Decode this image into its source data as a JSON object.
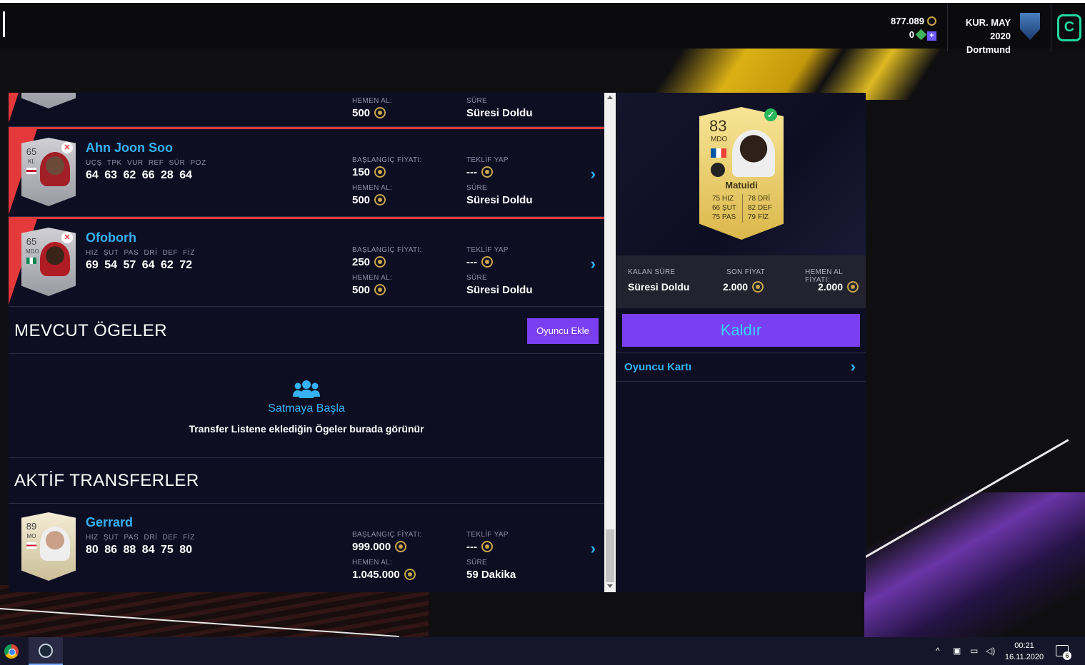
{
  "topbar": {
    "coins": "877.089",
    "points": "0",
    "season": "KUR. MAY 2020",
    "club": "Dortmund"
  },
  "items": [
    {
      "name": "",
      "label_a": "HEMEN AL:",
      "value_a": "500",
      "label_b": "SÜRE",
      "value_b": "Süresi Doldu"
    },
    {
      "name": "Ahn Joon Soo",
      "rating": "65",
      "position": "KL",
      "stat_labels": "UÇŞ TPK VUR REF SÜR POZ",
      "stat_values": "64 63 62 66 28 64",
      "start_label": "BAŞLANGIÇ FİYATI:",
      "start_price": "150",
      "bid_label": "TEKLİF YAP",
      "bid": "---",
      "buynow_label": "HEMEN AL:",
      "buynow": "500",
      "time_label": "SÜRE",
      "time": "Süresi Doldu"
    },
    {
      "name": "Ofoborh",
      "rating": "65",
      "position": "MDO",
      "stat_labels": "HIZ ŞUT PAS DRİ DEF FİZ",
      "stat_values": "69 54 57 64 62 72",
      "start_label": "BAŞLANGIÇ FİYATI:",
      "start_price": "250",
      "bid_label": "TEKLİF YAP",
      "bid": "---",
      "buynow_label": "HEMEN AL:",
      "buynow": "500",
      "time_label": "SÜRE",
      "time": "Süresi Doldu"
    }
  ],
  "available": {
    "title": "MEVCUT ÖGELER",
    "add_button": "Oyuncu Ekle",
    "empty_title": "Satmaya Başla",
    "empty_text": "Transfer Listene eklediğin Ögeler burada görünür"
  },
  "active": {
    "title": "AKTİF TRANSFERLER",
    "item": {
      "name": "Gerrard",
      "rating": "89",
      "position": "MO",
      "stat_labels": "HIZ ŞUT PAS DRİ DEF FİZ",
      "stat_values": "80 86 88 84 75 80",
      "start_label": "BAŞLANGIÇ FİYATI:",
      "start_price": "999.000",
      "bid_label": "TEKLİF YAP",
      "bid": "---",
      "buynow_label": "HEMEN AL:",
      "buynow": "1.045.000",
      "time_label": "SÜRE",
      "time": "59 Dakika"
    }
  },
  "detail": {
    "card": {
      "rating": "83",
      "position": "MDO",
      "name": "Matuidi",
      "stats_left": [
        "75 HIZ",
        "66 ŞUT",
        "75 PAS"
      ],
      "stats_right": [
        "78 DRİ",
        "82 DEF",
        "79 FİZ"
      ]
    },
    "remaining_label": "KALAN SÜRE",
    "remaining": "Süresi Doldu",
    "last_price_label": "SON FİYAT",
    "last_price": "2.000",
    "buynow_label": "HEMEN AL FİYATI:",
    "buynow": "2.000",
    "remove_button": "Kaldır",
    "player_card_link": "Oyuncu Kartı"
  },
  "taskbar": {
    "time": "00:21",
    "date": "16.11.2020",
    "notifications": "6"
  }
}
